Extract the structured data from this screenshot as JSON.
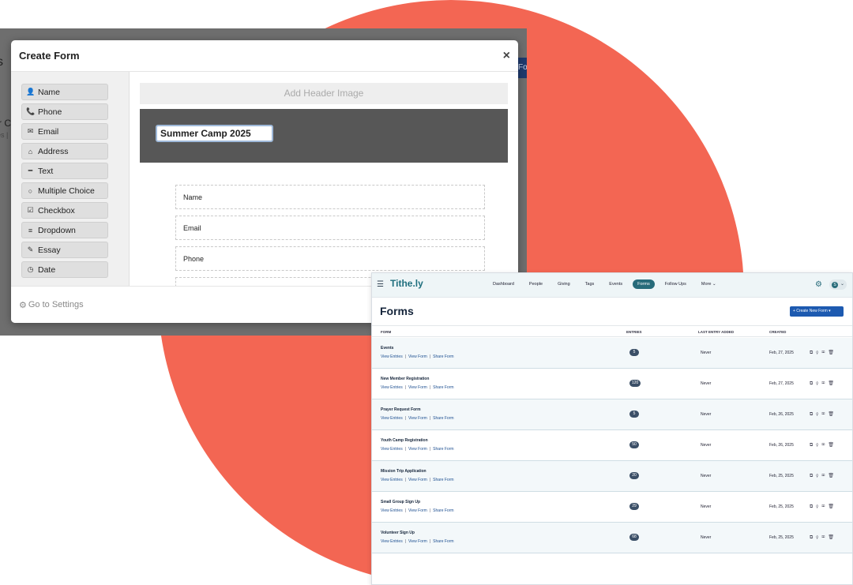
{
  "colors": {
    "circle": "#f36653",
    "app_accent": "#276b7a",
    "button_blue": "#1d5ab0"
  },
  "backdrop": {
    "frag_s": "s",
    "frag_c": "r C",
    "frag_es": "es |",
    "frag_fo": "Fo"
  },
  "modal": {
    "title": "Create Form",
    "close_label": "×",
    "tools": [
      {
        "icon": "user-icon",
        "glyph": "👤",
        "label": "Name"
      },
      {
        "icon": "phone-icon",
        "glyph": "📞",
        "label": "Phone"
      },
      {
        "icon": "envelope-icon",
        "glyph": "✉",
        "label": "Email"
      },
      {
        "icon": "home-icon",
        "glyph": "⌂",
        "label": "Address"
      },
      {
        "icon": "minus-icon",
        "glyph": "━",
        "label": "Text"
      },
      {
        "icon": "circle-icon",
        "glyph": "○",
        "label": "Multiple Choice"
      },
      {
        "icon": "checkbox-icon",
        "glyph": "☑",
        "label": "Checkbox"
      },
      {
        "icon": "list-icon",
        "glyph": "≡",
        "label": "Dropdown"
      },
      {
        "icon": "pencil-icon",
        "glyph": "✎",
        "label": "Essay"
      },
      {
        "icon": "clock-icon",
        "glyph": "◷",
        "label": "Date"
      }
    ],
    "header_image_label": "Add Header Image",
    "form_title_value": "Summer Camp 2025",
    "fields": [
      "Name",
      "Email",
      "Phone"
    ],
    "footer_label": "Go to Settings"
  },
  "app": {
    "logo": "Tithe.ly",
    "nav": [
      "Dashboard",
      "People",
      "Giving",
      "Tags",
      "Events",
      "Forms",
      "Follow Ups",
      "More ⌄"
    ],
    "active_nav": "Forms",
    "account_initial": "S",
    "page_title": "Forms",
    "create_button": "+  Create New Form  ▾",
    "columns": {
      "form": "FORM",
      "entries": "ENTRIES",
      "last_entry": "LAST ENTRY ADDED",
      "created": "CREATED"
    },
    "link_labels": {
      "view_entries": "View Entries",
      "view_form": "View Form",
      "share_form": "Share Form"
    },
    "rows": [
      {
        "name": "Events",
        "entries": "5",
        "last": "Never",
        "created": "Feb, 27, 2025"
      },
      {
        "name": "New Member Registration",
        "entries": "120",
        "last": "Never",
        "created": "Feb, 27, 2025"
      },
      {
        "name": "Prayer Request Form",
        "entries": "5",
        "last": "Never",
        "created": "Feb, 26, 2025"
      },
      {
        "name": "Youth Camp Registration",
        "entries": "50",
        "last": "Never",
        "created": "Feb, 26, 2025"
      },
      {
        "name": "Mission Trip Application",
        "entries": "20",
        "last": "Never",
        "created": "Feb, 25, 2025"
      },
      {
        "name": "Small Group Sign Up",
        "entries": "29",
        "last": "Never",
        "created": "Feb, 25, 2025"
      },
      {
        "name": "Volunteer Sign Up",
        "entries": "68",
        "last": "Never",
        "created": "Feb, 25, 2025"
      }
    ]
  }
}
